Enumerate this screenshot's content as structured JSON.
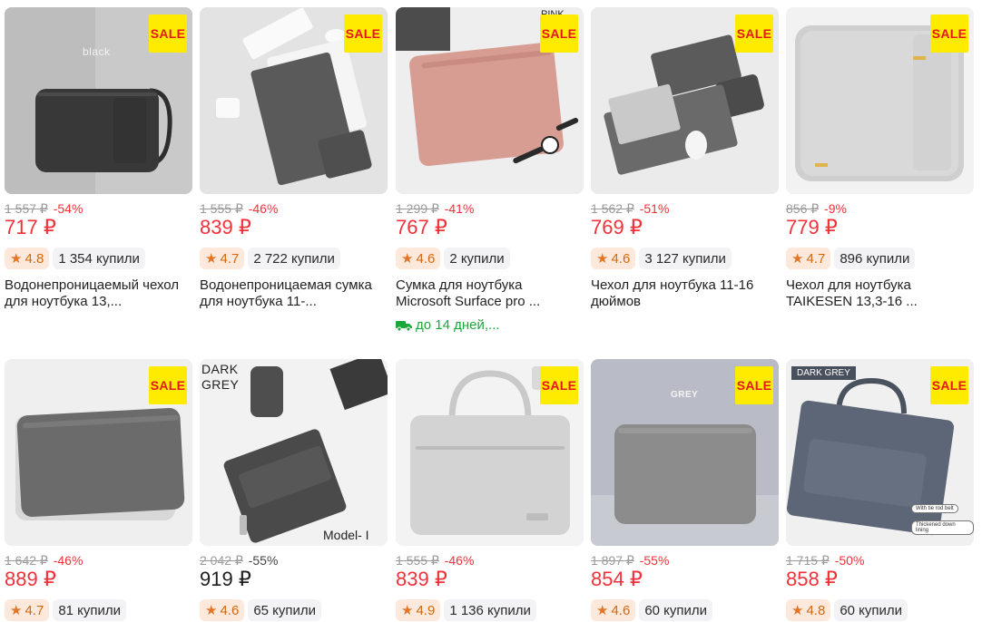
{
  "colors": {
    "price_red": "#f1313a",
    "rating_orange": "#d3690f",
    "sale_yellow": "#ffeb00",
    "delivery_green": "#1ba83b"
  },
  "sale_badge": "SALE",
  "products": [
    {
      "image_caption": "black",
      "old_price": "1 557 ₽",
      "discount": "-54%",
      "price": "717 ₽",
      "rating": "4.8",
      "bought": "1 354 купили",
      "title": "Водонепроницаемый чехол для ноутбука 13,..."
    },
    {
      "image_caption": "",
      "old_price": "1 555 ₽",
      "discount": "-46%",
      "price": "839 ₽",
      "rating": "4.7",
      "bought": "2 722 купили",
      "title": "Водонепроницаемая сумка для ноутбука 11-..."
    },
    {
      "image_caption": "PINK",
      "old_price": "1 299 ₽",
      "discount": "-41%",
      "price": "767 ₽",
      "rating": "4.6",
      "bought": "2 купили",
      "title": "Сумка для ноутбука Microsoft Surface pro ...",
      "delivery": "до 14 дней,..."
    },
    {
      "image_caption": "",
      "old_price": "1 562 ₽",
      "discount": "-51%",
      "price": "769 ₽",
      "rating": "4.6",
      "bought": "3 127 купили",
      "title": "Чехол для ноутбука 11-16 дюймов"
    },
    {
      "image_caption": "",
      "old_price": "856 ₽",
      "discount": "-9%",
      "price": "779 ₽",
      "rating": "4.7",
      "bought": "896 купили",
      "title": "Чехол для ноутбука TAIKESEN 13,3-16 ..."
    },
    {
      "image_caption": "",
      "old_price": "1 642 ₽",
      "discount": "-46%",
      "price": "889 ₽",
      "rating": "4.7",
      "bought": "81 купили",
      "title": ""
    },
    {
      "image_caption": "DARK GREY",
      "image_caption_2": "Model- I",
      "old_price": "2 042 ₽",
      "discount": "-55%",
      "price": "919 ₽",
      "rating": "4.6",
      "bought": "65 купили",
      "title": ""
    },
    {
      "image_caption": "",
      "old_price": "1 555 ₽",
      "discount": "-46%",
      "price": "839 ₽",
      "rating": "4.9",
      "bought": "1 136 купили",
      "title": ""
    },
    {
      "image_caption": "GREY",
      "old_price": "1 897 ₽",
      "discount": "-55%",
      "price": "854 ₽",
      "rating": "4.6",
      "bought": "60 купили",
      "title": ""
    },
    {
      "image_caption": "DARK GREY",
      "image_caption_2": "With tie rod belt",
      "image_caption_3": "Thickened down lining",
      "old_price": "1 715 ₽",
      "discount": "-50%",
      "price": "858 ₽",
      "rating": "4.8",
      "bought": "60 купили",
      "title": ""
    }
  ]
}
